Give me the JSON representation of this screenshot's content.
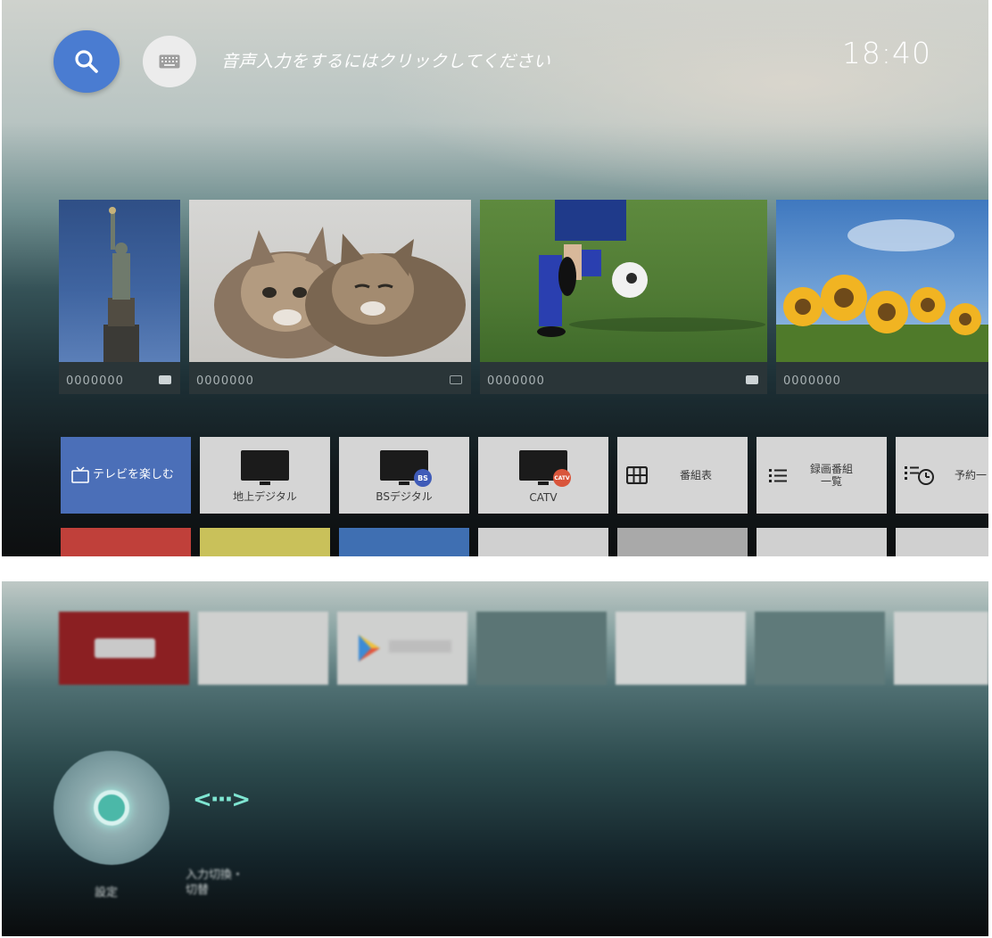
{
  "top_screen": {
    "voice_hint": "音声入力をするにはクリックしてください",
    "clock": "18:40",
    "icons": {
      "search": "search-icon",
      "keyboard": "keyboard-icon"
    },
    "cards": [
      {
        "label": "0000000",
        "badge": "filled"
      },
      {
        "label": "0000000",
        "badge": "cast"
      },
      {
        "label": "0000000",
        "badge": "play"
      },
      {
        "label": "0000000",
        "badge": "none"
      }
    ],
    "tiles": {
      "tv_enjoy": "テレビを楽しむ",
      "terrestrial": "地上デジタル",
      "bs": "BSデジタル",
      "bs_badge": "BS",
      "catv": "CATV",
      "catv_badge": "CATV",
      "epg": "番組表",
      "recordings_line1": "録画番組",
      "recordings_line2": "一覧",
      "reservations": "予約一"
    },
    "colors": {
      "accent_blue": "#4a7cd1",
      "tile_blue": "#4b6fb8",
      "red": "#c0403a",
      "yellow": "#c9c15a",
      "blue": "#3f6fb2"
    }
  },
  "bottom_screen": {
    "apps": [
      "YouTube",
      "",
      "Google Play",
      "",
      "",
      "",
      ""
    ],
    "settings_label": "設定",
    "input_switch_symbol": "<···>",
    "input_switch_label": "入力切換・\n切替"
  }
}
